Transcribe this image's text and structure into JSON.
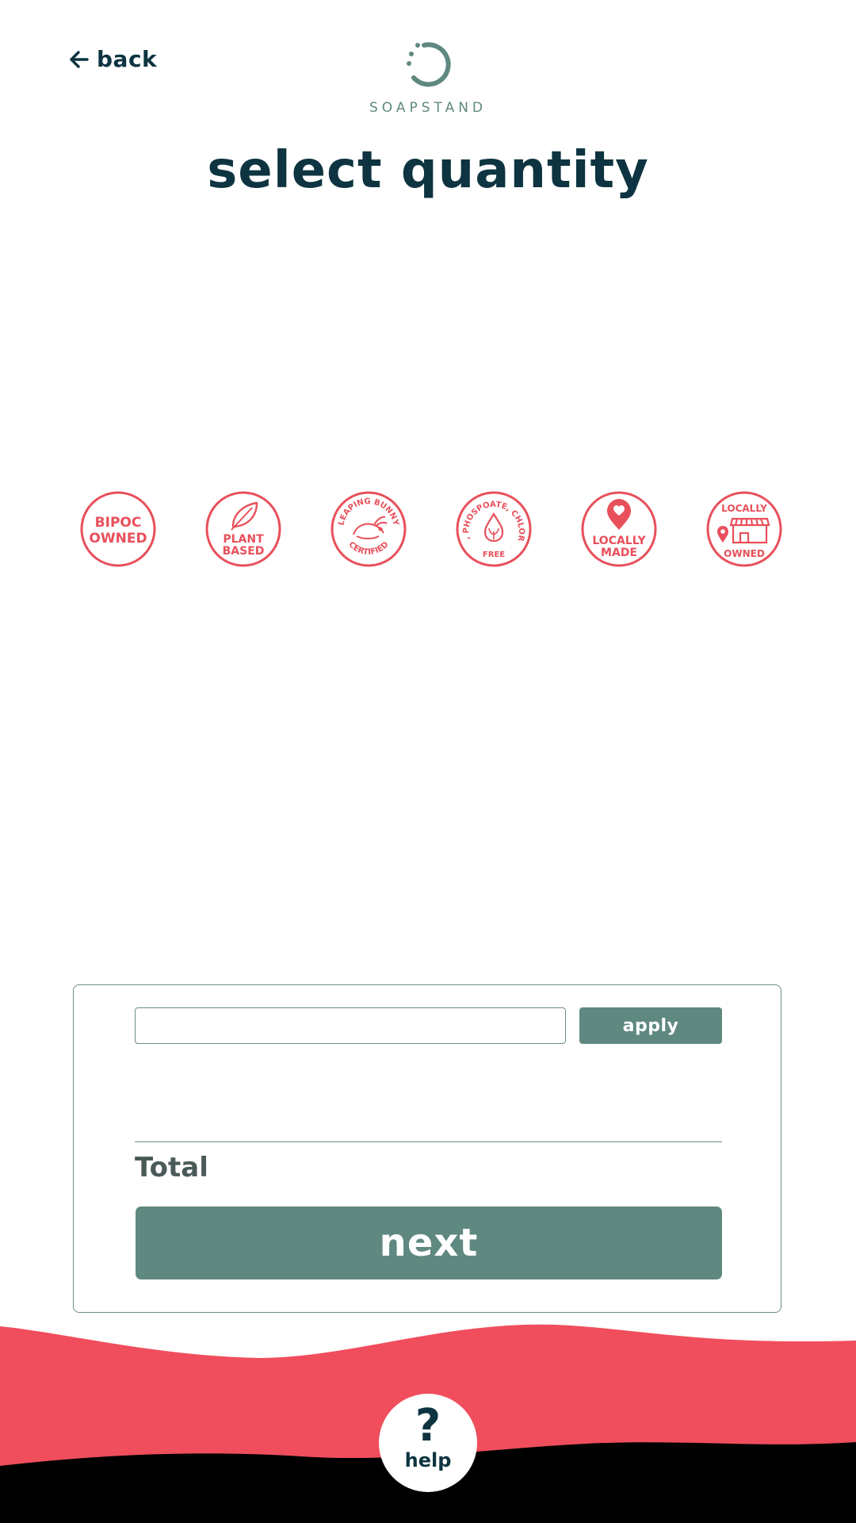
{
  "header": {
    "back_label": "back",
    "logo_text": "SOAPSTAND",
    "title": "select quantity"
  },
  "badges": [
    {
      "name": "bipoc-owned",
      "lines": [
        "BIPOC",
        "OWNED"
      ]
    },
    {
      "name": "plant-based",
      "lines": [
        "PLANT",
        "BASED"
      ]
    },
    {
      "name": "leaping-bunny-certified",
      "top": "LEAPING BUNNY",
      "bottom": "CERTIFIED"
    },
    {
      "name": "sls-phospoate-chlorine-free",
      "top": "SLS, PHOSPOATE, CHLORINE",
      "bottom": "FREE"
    },
    {
      "name": "locally-made",
      "lines": [
        "LOCALLY",
        "MADE"
      ]
    },
    {
      "name": "locally-owned",
      "top": "LOCALLY",
      "bottom": "OWNED"
    }
  ],
  "checkout": {
    "promo_value": "",
    "promo_placeholder": "",
    "apply_label": "apply",
    "total_label": "Total",
    "next_label": "next"
  },
  "footer": {
    "help_icon": "?",
    "help_label": "help"
  },
  "colors": {
    "primary_dark": "#0d3440",
    "accent_teal": "#5f8880",
    "badge_red": "#e8505b",
    "footer_red": "#f04e5c",
    "footer_black": "#000000"
  }
}
